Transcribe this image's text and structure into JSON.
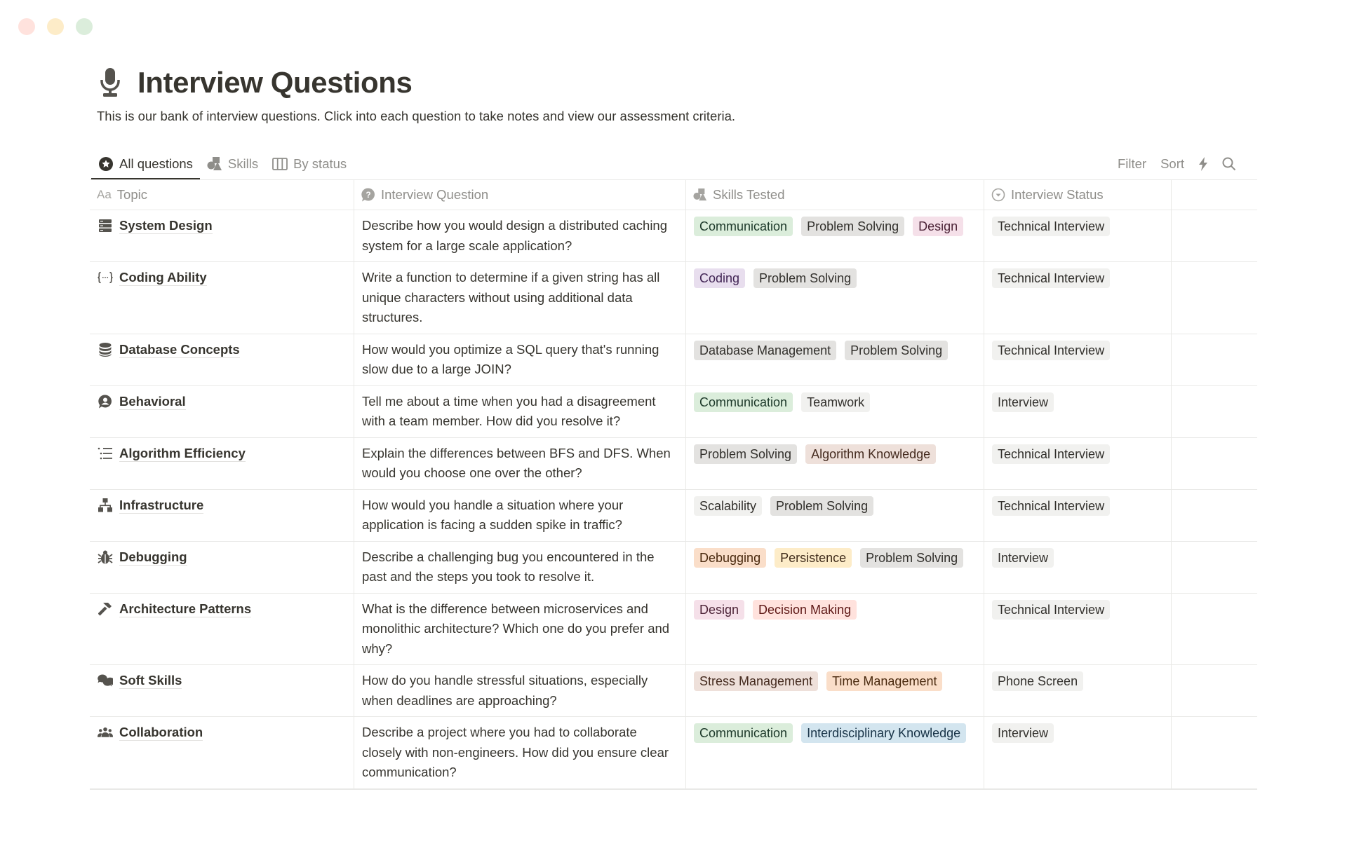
{
  "window": {
    "controls": [
      "close",
      "minimize",
      "maximize"
    ]
  },
  "page": {
    "icon": "microphone-icon",
    "title": "Interview Questions",
    "description": "This is our bank of interview questions. Click into each question to take notes and view our assessment criteria."
  },
  "views": [
    {
      "label": "All questions",
      "icon": "star-circle-icon",
      "active": true
    },
    {
      "label": "Skills",
      "icon": "shapes-icon",
      "active": false
    },
    {
      "label": "By status",
      "icon": "board-columns-icon",
      "active": false
    }
  ],
  "toolbar": {
    "filter_label": "Filter",
    "sort_label": "Sort",
    "automation_icon": "lightning-icon",
    "search_icon": "search-icon"
  },
  "columns": {
    "topic": {
      "label": "Topic",
      "prefix": "Aa"
    },
    "question": {
      "label": "Interview Question",
      "icon": "question-bubble-icon"
    },
    "skills": {
      "label": "Skills Tested",
      "icon": "shapes-icon"
    },
    "status": {
      "label": "Interview Status",
      "icon": "status-circle-icon"
    }
  },
  "rows": [
    {
      "topic": "System Design",
      "icon": "server-icon",
      "question": "Describe how you would design a distributed caching system for a large scale application?",
      "skills": [
        {
          "label": "Communication",
          "color": "green"
        },
        {
          "label": "Problem Solving",
          "color": "gray"
        },
        {
          "label": "Design",
          "color": "pink"
        }
      ],
      "status": "Technical Interview"
    },
    {
      "topic": "Coding Ability",
      "icon": "code-braces-icon",
      "question": "Write a function to determine if a given string has all unique characters without using additional data structures.",
      "skills": [
        {
          "label": "Coding",
          "color": "purple"
        },
        {
          "label": "Problem Solving",
          "color": "gray"
        }
      ],
      "status": "Technical Interview"
    },
    {
      "topic": "Database Concepts",
      "icon": "database-icon",
      "question": "How would you optimize a SQL query that's running slow due to a large JOIN?",
      "skills": [
        {
          "label": "Database Management",
          "color": "gray"
        },
        {
          "label": "Problem Solving",
          "color": "gray"
        }
      ],
      "status": "Technical Interview"
    },
    {
      "topic": "Behavioral",
      "icon": "person-bubble-icon",
      "question": "Tell me about a time when you had a disagreement with a team member. How did you resolve it?",
      "skills": [
        {
          "label": "Communication",
          "color": "green"
        },
        {
          "label": "Teamwork",
          "color": "light"
        }
      ],
      "status": "Interview"
    },
    {
      "topic": "Algorithm Efficiency",
      "icon": "list-indent-icon",
      "question": "Explain the differences between BFS and DFS. When would you choose one over the other?",
      "skills": [
        {
          "label": "Problem Solving",
          "color": "gray"
        },
        {
          "label": "Algorithm Knowledge",
          "color": "brown"
        }
      ],
      "status": "Technical Interview"
    },
    {
      "topic": "Infrastructure",
      "icon": "network-icon",
      "question": "How would you handle a situation where your application is facing a sudden spike in traffic?",
      "skills": [
        {
          "label": "Scalability",
          "color": "light"
        },
        {
          "label": "Problem Solving",
          "color": "gray"
        }
      ],
      "status": "Technical Interview"
    },
    {
      "topic": "Debugging",
      "icon": "bug-icon",
      "question": "Describe a challenging bug you encountered in the past and the steps you took to resolve it.",
      "skills": [
        {
          "label": "Debugging",
          "color": "orange"
        },
        {
          "label": "Persistence",
          "color": "yellow"
        },
        {
          "label": "Problem Solving",
          "color": "gray"
        }
      ],
      "status": "Interview"
    },
    {
      "topic": "Architecture Patterns",
      "icon": "hammer-icon",
      "question": "What is the difference between microservices and monolithic architecture? Which one do you prefer and why?",
      "skills": [
        {
          "label": "Design",
          "color": "pink"
        },
        {
          "label": "Decision Making",
          "color": "red"
        }
      ],
      "status": "Technical Interview"
    },
    {
      "topic": "Soft Skills",
      "icon": "chat-bubbles-icon",
      "question": "How do you handle stressful situations, especially when deadlines are approaching?",
      "skills": [
        {
          "label": "Stress Management",
          "color": "brown"
        },
        {
          "label": "Time Management",
          "color": "orange"
        }
      ],
      "status": "Phone Screen"
    },
    {
      "topic": "Collaboration",
      "icon": "people-group-icon",
      "question": "Describe a project where you had to collaborate closely with non-engineers. How did you ensure clear communication?",
      "skills": [
        {
          "label": "Communication",
          "color": "green"
        },
        {
          "label": "Interdisciplinary Knowledge",
          "color": "blue"
        }
      ],
      "status": "Interview"
    }
  ],
  "colors": {
    "text": "#37352f",
    "muted": "#8f8e8a",
    "border": "#e9e9e7",
    "tag_gray": "#e3e2e0",
    "tag_light": "#f1f1ef",
    "tag_green": "#dbeddb",
    "tag_pink": "#f5e0e9",
    "tag_purple": "#e8deee",
    "tag_brown": "#eee0da",
    "tag_orange": "#fadec9",
    "tag_yellow": "#fdecc8",
    "tag_red": "#ffe2dd",
    "tag_blue": "#d3e5ef"
  }
}
